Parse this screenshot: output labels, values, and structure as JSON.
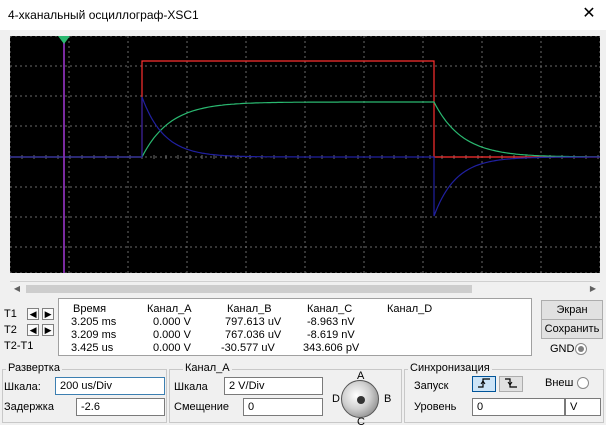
{
  "window": {
    "title": "4-хканальный осциллограф-XSC1",
    "close_glyph": "✕"
  },
  "readout": {
    "headers": [
      "Время",
      "Канал_A",
      "Канал_B",
      "Канал_C",
      "Канал_D"
    ],
    "rows": [
      {
        "label": "T1",
        "time": "3.205 ms",
        "a": "0.000 V",
        "b": "797.613 uV",
        "c": "-8.963 nV",
        "d": ""
      },
      {
        "label": "T2",
        "time": "3.209 ms",
        "a": "0.000 V",
        "b": "767.036 uV",
        "c": "-8.619 nV",
        "d": ""
      },
      {
        "label": "T2-T1",
        "time": "3.425 us",
        "a": "0.000 V",
        "b": "-30.577 uV",
        "c": "343.606 pV",
        "d": ""
      }
    ]
  },
  "side": {
    "screen_button": "Экран",
    "save_button": "Сохранить",
    "gnd_label": "GND"
  },
  "timebase": {
    "title": "Развертка",
    "scale_label": "Шкала:",
    "scale_value": "200 us/Div",
    "delay_label": "Задержка",
    "delay_value": "-2.6"
  },
  "channel": {
    "title": "Канал_A",
    "scale_label": "Шкала",
    "scale_value": "2  V/Div",
    "offset_label": "Смещение",
    "offset_value": "0"
  },
  "selector": {
    "a": "A",
    "b": "B",
    "c": "C",
    "d": "D"
  },
  "trigger": {
    "title": "Синхронизация",
    "start_label": "Запуск",
    "level_label": "Уровень",
    "level_value": "0",
    "level_unit": "V",
    "ext_label": "Внеш"
  },
  "colors": {
    "ch_a": "#ff3030",
    "ch_b": "#2ab870",
    "ch_c": "#2020a0",
    "ch_d": "#808080",
    "cursor": "#7a2aa0",
    "grid": "#6a6a6a"
  }
}
